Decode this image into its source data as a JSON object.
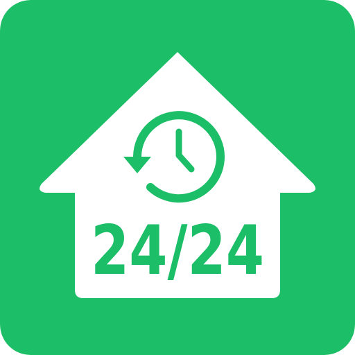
{
  "icon": {
    "name": "house-clock-24-24-app-icon",
    "label": "24/24",
    "colors": {
      "background": "#1DBE68",
      "house": "#FFFFFF",
      "accent": "#1DBE68"
    }
  }
}
